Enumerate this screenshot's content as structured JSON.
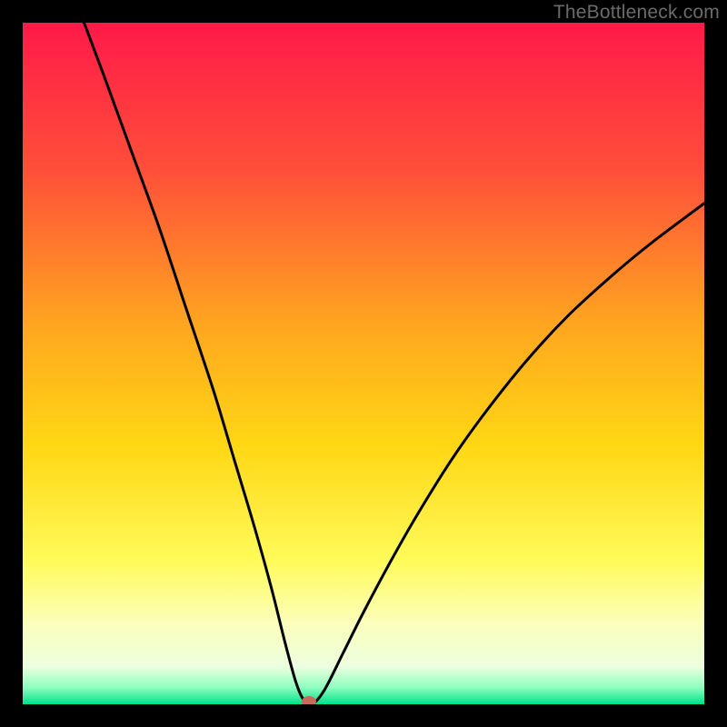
{
  "watermark": "TheBottleneck.com",
  "chart_data": {
    "type": "line",
    "title": "",
    "xlabel": "",
    "ylabel": "",
    "xlim": [
      0,
      100
    ],
    "ylim": [
      0,
      100
    ],
    "grid": false,
    "legend": false,
    "gradient_stops": [
      {
        "offset": 0.0,
        "color": "#ff1a49"
      },
      {
        "offset": 0.22,
        "color": "#ff5039"
      },
      {
        "offset": 0.45,
        "color": "#ffa81f"
      },
      {
        "offset": 0.62,
        "color": "#ffd714"
      },
      {
        "offset": 0.79,
        "color": "#fffb5a"
      },
      {
        "offset": 0.88,
        "color": "#fbffba"
      },
      {
        "offset": 0.945,
        "color": "#ecffdf"
      },
      {
        "offset": 0.975,
        "color": "#8fffc0"
      },
      {
        "offset": 1.0,
        "color": "#00e08a"
      }
    ],
    "marker": {
      "x": 42,
      "y": 0,
      "color": "#c96b5c"
    },
    "series": [
      {
        "name": "curve",
        "points": [
          {
            "x": 9.0,
            "y": 100.0
          },
          {
            "x": 12.0,
            "y": 92.0
          },
          {
            "x": 16.0,
            "y": 81.0
          },
          {
            "x": 20.0,
            "y": 70.0
          },
          {
            "x": 24.0,
            "y": 58.0
          },
          {
            "x": 28.0,
            "y": 46.0
          },
          {
            "x": 31.0,
            "y": 36.0
          },
          {
            "x": 34.0,
            "y": 26.0
          },
          {
            "x": 36.5,
            "y": 17.0
          },
          {
            "x": 38.5,
            "y": 9.0
          },
          {
            "x": 40.0,
            "y": 3.5
          },
          {
            "x": 41.0,
            "y": 1.0
          },
          {
            "x": 42.0,
            "y": 0.0
          },
          {
            "x": 43.0,
            "y": 0.4
          },
          {
            "x": 44.5,
            "y": 2.5
          },
          {
            "x": 47.0,
            "y": 7.5
          },
          {
            "x": 50.0,
            "y": 13.5
          },
          {
            "x": 54.0,
            "y": 21.0
          },
          {
            "x": 58.0,
            "y": 28.0
          },
          {
            "x": 63.0,
            "y": 36.0
          },
          {
            "x": 68.0,
            "y": 43.0
          },
          {
            "x": 74.0,
            "y": 50.5
          },
          {
            "x": 80.0,
            "y": 57.0
          },
          {
            "x": 86.0,
            "y": 62.5
          },
          {
            "x": 92.0,
            "y": 67.5
          },
          {
            "x": 100.0,
            "y": 73.5
          }
        ]
      }
    ]
  }
}
